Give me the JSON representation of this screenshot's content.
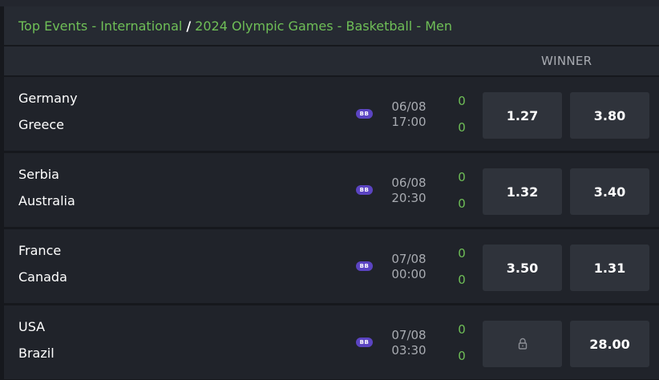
{
  "breadcrumb": {
    "part1": "Top Events - International",
    "separator": "/",
    "part2": "2024 Olympic Games - Basketball - Men"
  },
  "market": {
    "title": "WINNER"
  },
  "colors": {
    "accent": "#6fbf57",
    "badge": "#5b44c2"
  },
  "matches": [
    {
      "home": "Germany",
      "away": "Greece",
      "badge": "BB",
      "date": "06/08",
      "time": "17:00",
      "score_home": "0",
      "score_away": "0",
      "odd1": "1.27",
      "odd2": "3.80",
      "odd1_locked": false
    },
    {
      "home": "Serbia",
      "away": "Australia",
      "badge": "BB",
      "date": "06/08",
      "time": "20:30",
      "score_home": "0",
      "score_away": "0",
      "odd1": "1.32",
      "odd2": "3.40",
      "odd1_locked": false
    },
    {
      "home": "France",
      "away": "Canada",
      "badge": "BB",
      "date": "07/08",
      "time": "00:00",
      "score_home": "0",
      "score_away": "0",
      "odd1": "3.50",
      "odd2": "1.31",
      "odd1_locked": false
    },
    {
      "home": "USA",
      "away": "Brazil",
      "badge": "BB",
      "date": "07/08",
      "time": "03:30",
      "score_home": "0",
      "score_away": "0",
      "odd1": "",
      "odd2": "28.00",
      "odd1_locked": true,
      "odd1_icon": "lock-icon"
    }
  ]
}
